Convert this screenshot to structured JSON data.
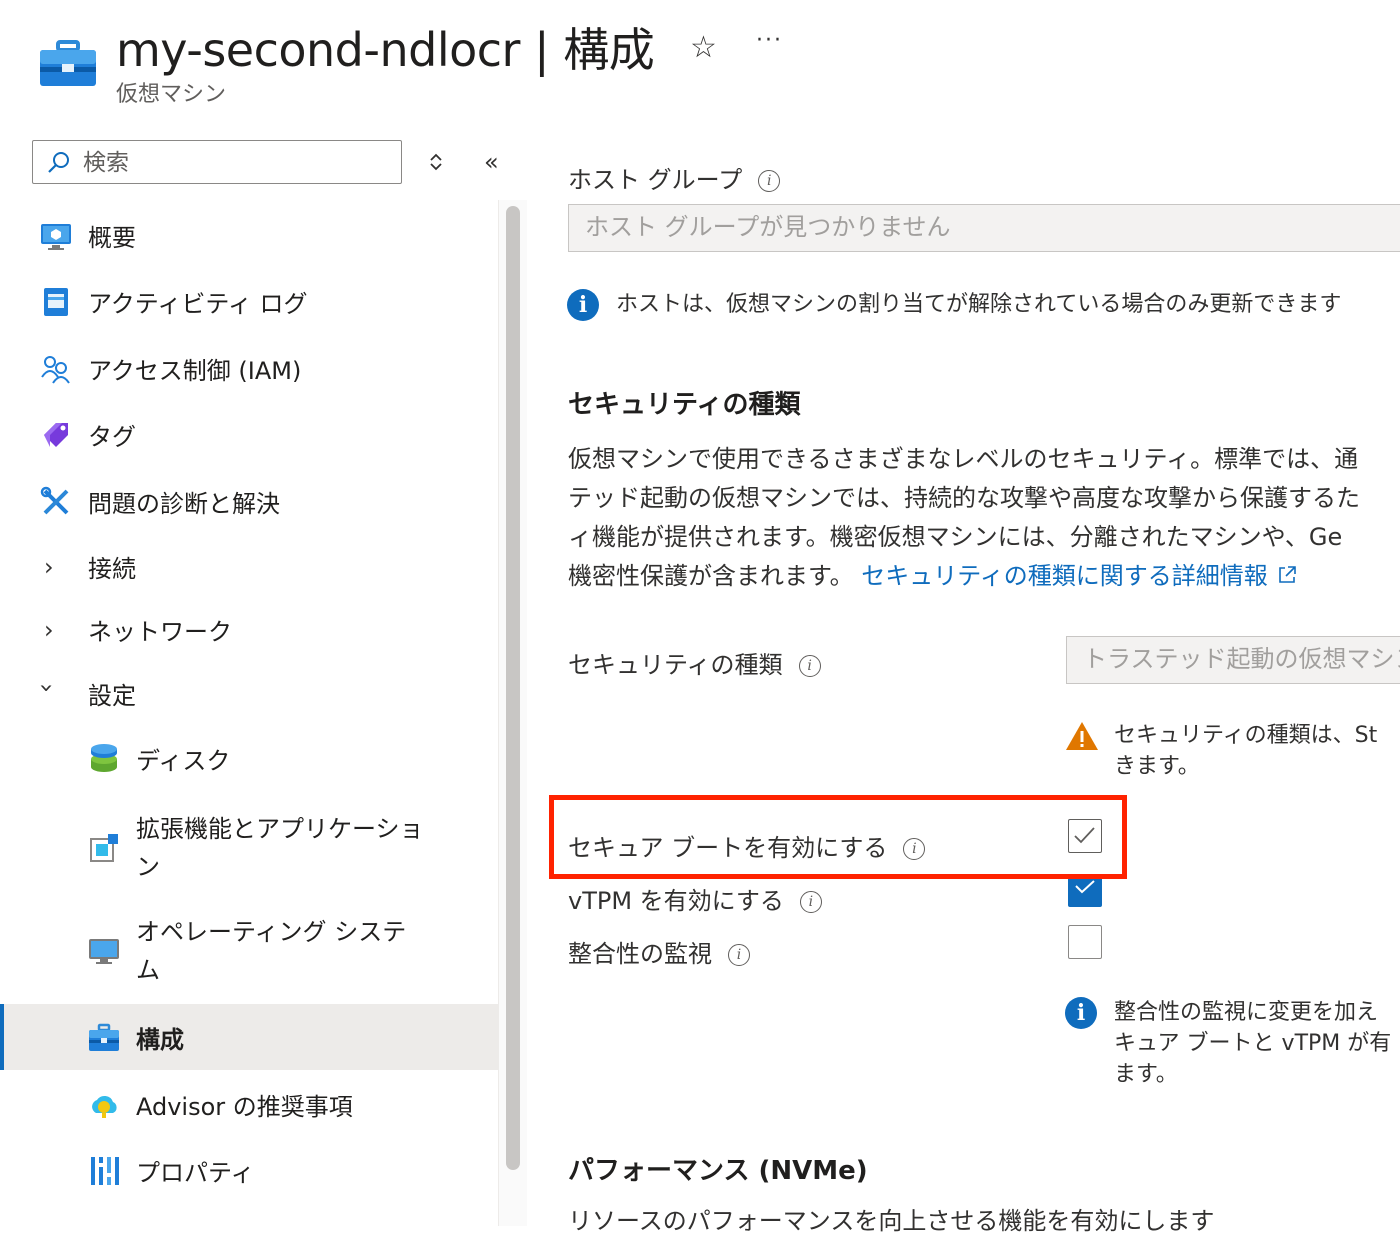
{
  "header": {
    "title": "my-second-ndlocr | 構成",
    "subtitle": "仮想マシン",
    "favorite_icon": "star-icon",
    "more_label": "···"
  },
  "search": {
    "placeholder": "検索",
    "value": ""
  },
  "sidebar": {
    "items": [
      {
        "label": "概要",
        "icon": "overview-monitor-icon"
      },
      {
        "label": "アクティビティ ログ",
        "icon": "activity-log-icon"
      },
      {
        "label": "アクセス制御 (IAM)",
        "icon": "people-icon"
      },
      {
        "label": "タグ",
        "icon": "tag-icon"
      },
      {
        "label": "問題の診断と解決",
        "icon": "wrench-icon"
      },
      {
        "label": "接続",
        "icon": "chevron-right-icon"
      },
      {
        "label": "ネットワーク",
        "icon": "chevron-right-icon"
      },
      {
        "label": "設定",
        "icon": "chevron-down-icon"
      },
      {
        "label": "ディスク",
        "icon": "disk-icon"
      },
      {
        "label": "拡張機能とアプリケーション",
        "icon": "extensions-icon"
      },
      {
        "label": "オペレーティング システム",
        "icon": "monitor-icon"
      },
      {
        "label": "構成",
        "icon": "configuration-icon",
        "selected": true
      },
      {
        "label": "Advisor の推奨事項",
        "icon": "advisor-cloud-icon"
      },
      {
        "label": "プロパティ",
        "icon": "properties-bars-icon"
      }
    ]
  },
  "content": {
    "host_group_label": "ホスト グループ",
    "host_group_placeholder": "ホスト グループが見つかりません",
    "host_info": "ホストは、仮想マシンの割り当てが解除されている場合のみ更新できます",
    "security_heading": "セキュリティの種類",
    "security_desc_lines": [
      "仮想マシンで使用できるさまざまなレベルのセキュリティ。標準では、通",
      "テッド起動の仮想マシンでは、持続的な攻撃や高度な攻撃から保護するた",
      "ィ機能が提供されます。機密仮想マシンには、分離されたマシンや、Ge",
      "機密性保護が含まれます。"
    ],
    "security_link": "セキュリティの種類に関する詳細情報",
    "security_type_label": "セキュリティの種類",
    "security_type_value": "トラステッド起動の仮想マシン",
    "security_warning_lines": [
      "セキュリティの種類は、St",
      "きます。"
    ],
    "secure_boot_label": "セキュア ブートを有効にする",
    "secure_boot_checked": true,
    "vtpm_label": "vTPM を有効にする",
    "vtpm_checked": true,
    "integrity_label": "整合性の監視",
    "integrity_checked": false,
    "integrity_info_lines": [
      "整合性の監視に変更を加え",
      "キュア ブートと vTPM が有",
      "ます。"
    ],
    "performance_heading": "パフォーマンス (NVMe)",
    "performance_desc": "リソースのパフォーマンスを向上させる機能を有効にします"
  },
  "colors": {
    "accent": "#0f6cbd",
    "highlight": "#ff2200",
    "warning": "#e07700",
    "selected_bg": "#edebe9"
  }
}
